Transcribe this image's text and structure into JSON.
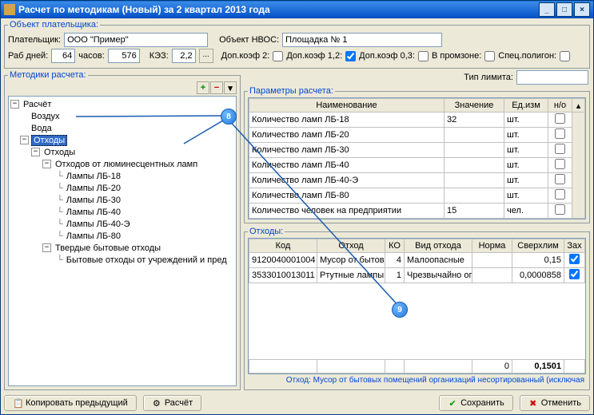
{
  "window": {
    "title": "Расчет по методикам (Новый) за 2 квартал 2013 года"
  },
  "payer": {
    "group_label": "Объект плательщика:",
    "payer_label": "Плательщик:",
    "payer_value": "ООО \"Пример\"",
    "object_label": "Объект НВОС:",
    "object_value": "Площадка № 1",
    "days_label": "Раб дней:",
    "days_value": "64",
    "hours_label": "часов:",
    "hours_value": "576",
    "kez_label": "КЭЗ:",
    "kez_value": "2,2",
    "dop2_label": "Доп.коэф 2:",
    "dop12_label": "Доп.коэф 1,2:",
    "dop03_label": "Доп.коэф 0,3:",
    "promzone_label": "В промзоне:",
    "spec_label": "Спец.полигон:"
  },
  "methods": {
    "group_label": "Методики расчета:",
    "limit_label": "Тип лимита:",
    "limit_value": ""
  },
  "tree": {
    "root": "Расчёт",
    "air": "Воздух",
    "water": "Вода",
    "waste": "Отходы",
    "waste2": "Отходы",
    "lumin": "Отходов от люминесцентных ламп",
    "l18": "Лампы ЛБ-18",
    "l20": "Лампы ЛБ-20",
    "l30": "Лампы ЛБ-30",
    "l40": "Лампы ЛБ-40",
    "l40e": "Лампы ЛБ-40-Э",
    "l80": "Лампы ЛБ-80",
    "solid": "Твердые бытовые отходы",
    "solid_sub": "Бытовые отходы от учреждений и пред"
  },
  "params": {
    "group_label": "Параметры расчета:",
    "col_name": "Наименование",
    "col_val": "Значение",
    "col_unit": "Ед.изм",
    "col_no": "н/о",
    "rows": [
      {
        "name": "Количество ламп ЛБ-18",
        "val": "32",
        "unit": "шт."
      },
      {
        "name": "Количество ламп ЛБ-20",
        "val": "",
        "unit": "шт."
      },
      {
        "name": "Количество ламп ЛБ-30",
        "val": "",
        "unit": "шт."
      },
      {
        "name": "Количество ламп ЛБ-40",
        "val": "",
        "unit": "шт."
      },
      {
        "name": "Количество ламп ЛБ-40-Э",
        "val": "",
        "unit": "шт."
      },
      {
        "name": "Количество ламп ЛБ-80",
        "val": "",
        "unit": "шт."
      },
      {
        "name": "Количество человек на предприятии",
        "val": "15",
        "unit": "чел."
      }
    ]
  },
  "waste_grid": {
    "group_label": "Отходы:",
    "col_code": "Код",
    "col_waste": "Отход",
    "col_ko": "КО",
    "col_type": "Вид отхода",
    "col_norm": "Норма",
    "col_over": "Сверхлим",
    "col_za": "Зах",
    "rows": [
      {
        "code": "9120040001004",
        "waste": "Мусор от бытовы",
        "ko": "4",
        "type": "Малоопасные",
        "norm": "",
        "over": "0,15",
        "za": true
      },
      {
        "code": "3533010013011",
        "waste": "Ртутные лампы,",
        "ko": "1",
        "type": "Чрезвычайно ог",
        "norm": "",
        "over": "0,0000858",
        "za": true
      }
    ],
    "sum_norm": "0",
    "sum_over": "0,1501",
    "status": "Отход: Мусор от бытовых помещений организаций несортированный (исключая"
  },
  "buttons": {
    "copy": "Копировать предыдущий",
    "calc": "Расчёт",
    "save": "Сохранить",
    "cancel": "Отменить"
  },
  "annot": {
    "a8": "8",
    "a9": "9"
  }
}
